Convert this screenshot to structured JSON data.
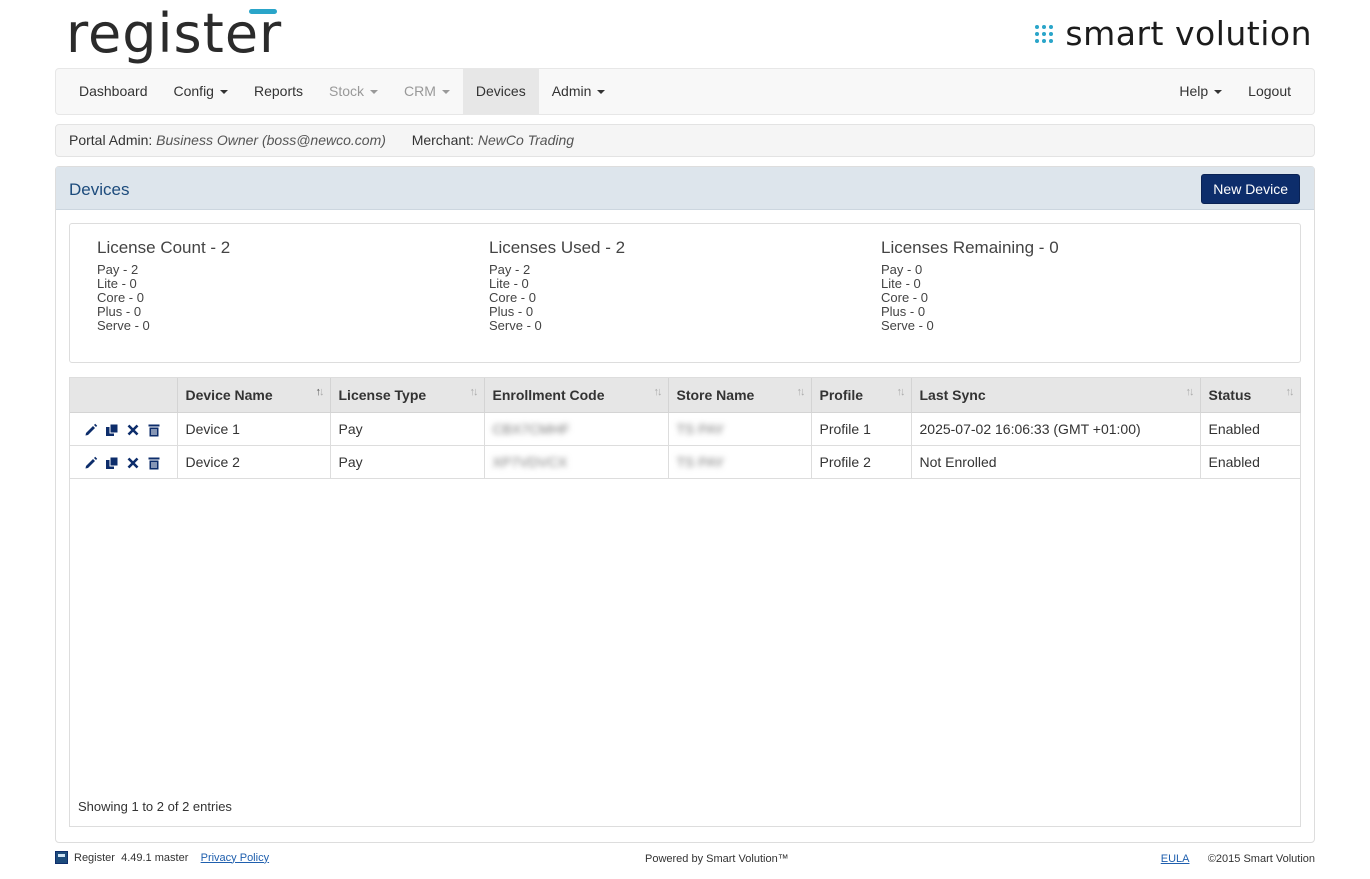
{
  "brand": {
    "left_logo": "register",
    "right_logo": "smart volution",
    "accent_color": "#2aa5c9"
  },
  "nav": {
    "left": [
      {
        "label": "Dashboard",
        "dropdown": false,
        "state": "normal"
      },
      {
        "label": "Config",
        "dropdown": true,
        "state": "normal"
      },
      {
        "label": "Reports",
        "dropdown": false,
        "state": "normal"
      },
      {
        "label": "Stock",
        "dropdown": true,
        "state": "disabled"
      },
      {
        "label": "CRM",
        "dropdown": true,
        "state": "disabled"
      },
      {
        "label": "Devices",
        "dropdown": false,
        "state": "active"
      },
      {
        "label": "Admin",
        "dropdown": true,
        "state": "normal"
      }
    ],
    "right": [
      {
        "label": "Help",
        "dropdown": true
      },
      {
        "label": "Logout",
        "dropdown": false
      }
    ]
  },
  "info": {
    "admin_label": "Portal Admin:",
    "admin_value": "Business Owner (boss@newco.com)",
    "merchant_label": "Merchant:",
    "merchant_value": "NewCo Trading"
  },
  "panel": {
    "title": "Devices",
    "new_button": "New Device"
  },
  "licenses": [
    {
      "title": "License Count - 2",
      "rows": [
        "Pay - 2",
        "Lite - 0",
        "Core - 0",
        "Plus - 0",
        "Serve - 0"
      ]
    },
    {
      "title": "Licenses Used - 2",
      "rows": [
        "Pay - 2",
        "Lite - 0",
        "Core - 0",
        "Plus - 0",
        "Serve - 0"
      ]
    },
    {
      "title": "Licenses Remaining - 0",
      "rows": [
        "Pay - 0",
        "Lite - 0",
        "Core - 0",
        "Plus - 0",
        "Serve - 0"
      ]
    }
  ],
  "table": {
    "columns": [
      "",
      "Device Name",
      "License Type",
      "Enrollment Code",
      "Store Name",
      "Profile",
      "Last Sync",
      "Status"
    ],
    "rows": [
      {
        "device_name": "Device 1",
        "license_type": "Pay",
        "enrollment_code": "CBX7CMHF",
        "store_name": "TS PAY",
        "profile": "Profile 1",
        "last_sync": "2025-07-02 16:06:33 (GMT +01:00)",
        "status": "Enabled"
      },
      {
        "device_name": "Device 2",
        "license_type": "Pay",
        "enrollment_code": "XP7VDVCX",
        "store_name": "TS PAY",
        "profile": "Profile 2",
        "last_sync": "Not Enrolled",
        "status": "Enabled"
      }
    ],
    "showing": "Showing 1 to 2 of 2 entries"
  },
  "footer": {
    "app_name": "Register",
    "version": "4.49.1",
    "branch": "master",
    "privacy": "Privacy Policy",
    "powered": "Powered by Smart Volution™",
    "eula": "EULA",
    "copyright": "©2015 Smart Volution"
  }
}
